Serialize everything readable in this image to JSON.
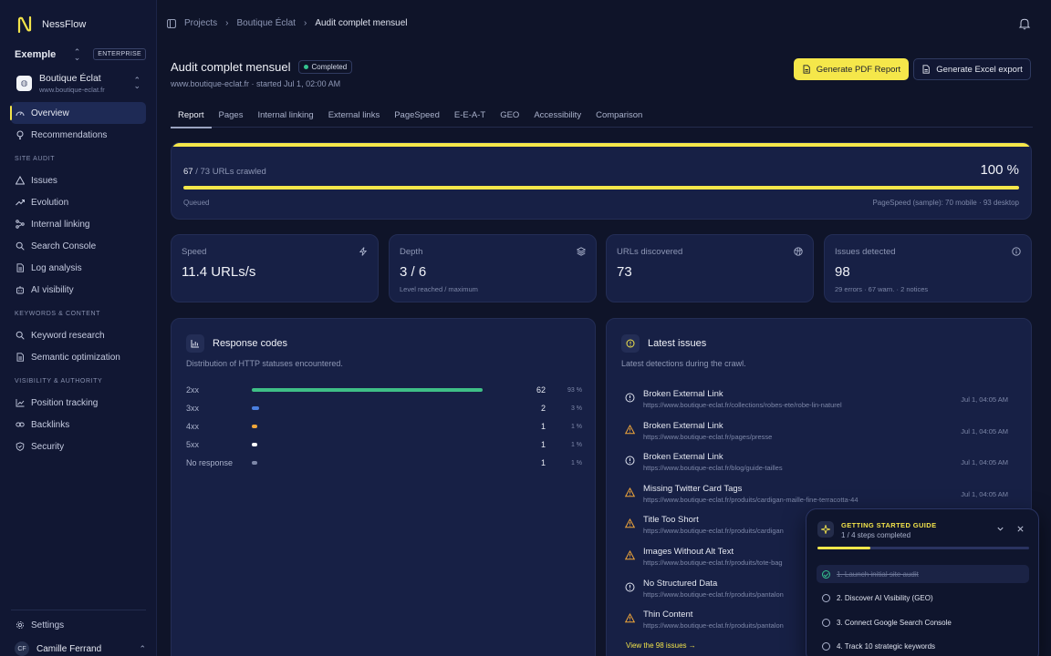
{
  "brand": {
    "name": "NessFlow"
  },
  "workspace": {
    "name": "Exemple",
    "badge": "ENTERPRISE"
  },
  "site": {
    "name": "Boutique Éclat",
    "url": "www.boutique-eclat.fr"
  },
  "nav": {
    "overview": "Overview",
    "recommendations": "Recommendations",
    "section_site_audit": "SITE AUDIT",
    "issues": "Issues",
    "evolution": "Evolution",
    "internal_linking": "Internal linking",
    "search_console": "Search Console",
    "log_analysis": "Log analysis",
    "ai_visibility": "AI visibility",
    "section_keywords": "KEYWORDS & CONTENT",
    "keyword_research": "Keyword research",
    "semantic_optimization": "Semantic optimization",
    "section_visibility": "VISIBILITY & AUTHORITY",
    "position_tracking": "Position tracking",
    "backlinks": "Backlinks",
    "security": "Security",
    "settings": "Settings"
  },
  "user": {
    "initials": "CF",
    "name": "Camille Ferrand"
  },
  "breadcrumb": [
    "Projects",
    "Boutique Éclat",
    "Audit complet mensuel"
  ],
  "page": {
    "title": "Audit complet mensuel",
    "status": "Completed",
    "subtitle": "www.boutique-eclat.fr · started Jul 1, 02:00 AM",
    "btn_pdf": "Generate PDF Report",
    "btn_excel": "Generate Excel export"
  },
  "tabs": [
    "Report",
    "Pages",
    "Internal linking",
    "External links",
    "PageSpeed",
    "E-E-A-T",
    "GEO",
    "Accessibility",
    "Comparison"
  ],
  "progress": {
    "crawled_count": "67",
    "crawled_total": "/ 73 URLs crawled",
    "percent_text": "100 %",
    "fill_fraction": 1.0,
    "state": "Queued",
    "pagespeed_note": "PageSpeed (sample): 70 mobile · 93 desktop"
  },
  "stats": {
    "speed": {
      "label": "Speed",
      "value": "11.4 URLs/s",
      "sub": ""
    },
    "depth": {
      "label": "Depth",
      "value": "3 / 6",
      "sub": "Level reached / maximum"
    },
    "urls": {
      "label": "URLs discovered",
      "value": "73",
      "sub": ""
    },
    "issues": {
      "label": "Issues detected",
      "value": "98",
      "sub": "29 errors · 67 warn. · 2 notices"
    }
  },
  "response_codes": {
    "title": "Response codes",
    "desc": "Distribution of HTTP statuses encountered.",
    "rows": [
      {
        "label": "2xx",
        "count": "62",
        "pct": "93 %",
        "fraction": 0.93,
        "color": "#3fbf86"
      },
      {
        "label": "3xx",
        "count": "2",
        "pct": "3 %",
        "fraction": 0.03,
        "color": "#4a7fe0"
      },
      {
        "label": "4xx",
        "count": "1",
        "pct": "1 %",
        "fraction": 0.015,
        "color": "#f0a63a"
      },
      {
        "label": "5xx",
        "count": "1",
        "pct": "1 %",
        "fraction": 0.015,
        "color": "#ffffff"
      },
      {
        "label": "No response",
        "count": "1",
        "pct": "1 %",
        "fraction": 0.015,
        "color": "#7d87a8"
      }
    ]
  },
  "latest_issues": {
    "title": "Latest issues",
    "desc": "Latest detections during the crawl.",
    "items": [
      {
        "title": "Broken External Link",
        "url": "https://www.boutique-eclat.fr/collections/robes-ete/robe-lin-naturel",
        "time": "Jul 1, 04:05 AM",
        "kind": "error"
      },
      {
        "title": "Broken External Link",
        "url": "https://www.boutique-eclat.fr/pages/presse",
        "time": "Jul 1, 04:05 AM",
        "kind": "warning"
      },
      {
        "title": "Broken External Link",
        "url": "https://www.boutique-eclat.fr/blog/guide-tailles",
        "time": "Jul 1, 04:05 AM",
        "kind": "error"
      },
      {
        "title": "Missing Twitter Card Tags",
        "url": "https://www.boutique-eclat.fr/produits/cardigan-maille-fine-terracotta-44",
        "time": "Jul 1, 04:05 AM",
        "kind": "warning"
      },
      {
        "title": "Title Too Short",
        "url": "https://www.boutique-eclat.fr/produits/cardigan",
        "time": "",
        "kind": "warning"
      },
      {
        "title": "Images Without Alt Text",
        "url": "https://www.boutique-eclat.fr/produits/tote-bag",
        "time": "",
        "kind": "warning"
      },
      {
        "title": "No Structured Data",
        "url": "https://www.boutique-eclat.fr/produits/pantalon",
        "time": "",
        "kind": "error"
      },
      {
        "title": "Thin Content",
        "url": "https://www.boutique-eclat.fr/produits/pantalon",
        "time": "",
        "kind": "warning"
      }
    ],
    "view_all": "View the 98 issues →"
  },
  "guide": {
    "title": "GETTING STARTED GUIDE",
    "progress": "1 / 4 steps completed",
    "fill_fraction": 0.25,
    "steps": [
      {
        "label": "1. Launch initial site audit",
        "done": true
      },
      {
        "label": "2. Discover AI Visibility (GEO)",
        "done": false
      },
      {
        "label": "3. Connect Google Search Console",
        "done": false
      },
      {
        "label": "4. Track 10 strategic keywords",
        "done": false
      }
    ]
  },
  "colors": {
    "accent": "#f5e74a",
    "background": "#0f1429",
    "card": "#172045",
    "success": "#34c38f",
    "warning": "#f0a63a"
  }
}
